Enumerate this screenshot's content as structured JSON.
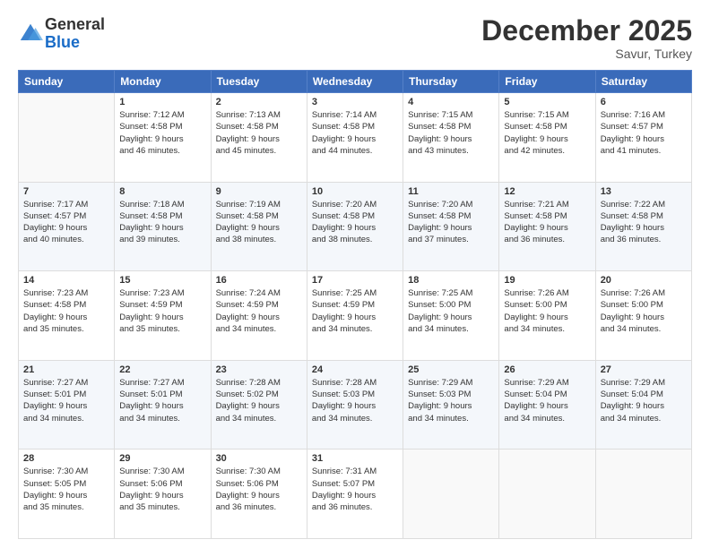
{
  "header": {
    "logo_line1": "General",
    "logo_line2": "Blue",
    "month": "December 2025",
    "location": "Savur, Turkey"
  },
  "days_of_week": [
    "Sunday",
    "Monday",
    "Tuesday",
    "Wednesday",
    "Thursday",
    "Friday",
    "Saturday"
  ],
  "weeks": [
    [
      {
        "day": "",
        "info": ""
      },
      {
        "day": "1",
        "info": "Sunrise: 7:12 AM\nSunset: 4:58 PM\nDaylight: 9 hours\nand 46 minutes."
      },
      {
        "day": "2",
        "info": "Sunrise: 7:13 AM\nSunset: 4:58 PM\nDaylight: 9 hours\nand 45 minutes."
      },
      {
        "day": "3",
        "info": "Sunrise: 7:14 AM\nSunset: 4:58 PM\nDaylight: 9 hours\nand 44 minutes."
      },
      {
        "day": "4",
        "info": "Sunrise: 7:15 AM\nSunset: 4:58 PM\nDaylight: 9 hours\nand 43 minutes."
      },
      {
        "day": "5",
        "info": "Sunrise: 7:15 AM\nSunset: 4:58 PM\nDaylight: 9 hours\nand 42 minutes."
      },
      {
        "day": "6",
        "info": "Sunrise: 7:16 AM\nSunset: 4:57 PM\nDaylight: 9 hours\nand 41 minutes."
      }
    ],
    [
      {
        "day": "7",
        "info": "Sunrise: 7:17 AM\nSunset: 4:57 PM\nDaylight: 9 hours\nand 40 minutes."
      },
      {
        "day": "8",
        "info": "Sunrise: 7:18 AM\nSunset: 4:58 PM\nDaylight: 9 hours\nand 39 minutes."
      },
      {
        "day": "9",
        "info": "Sunrise: 7:19 AM\nSunset: 4:58 PM\nDaylight: 9 hours\nand 38 minutes."
      },
      {
        "day": "10",
        "info": "Sunrise: 7:20 AM\nSunset: 4:58 PM\nDaylight: 9 hours\nand 38 minutes."
      },
      {
        "day": "11",
        "info": "Sunrise: 7:20 AM\nSunset: 4:58 PM\nDaylight: 9 hours\nand 37 minutes."
      },
      {
        "day": "12",
        "info": "Sunrise: 7:21 AM\nSunset: 4:58 PM\nDaylight: 9 hours\nand 36 minutes."
      },
      {
        "day": "13",
        "info": "Sunrise: 7:22 AM\nSunset: 4:58 PM\nDaylight: 9 hours\nand 36 minutes."
      }
    ],
    [
      {
        "day": "14",
        "info": "Sunrise: 7:23 AM\nSunset: 4:58 PM\nDaylight: 9 hours\nand 35 minutes."
      },
      {
        "day": "15",
        "info": "Sunrise: 7:23 AM\nSunset: 4:59 PM\nDaylight: 9 hours\nand 35 minutes."
      },
      {
        "day": "16",
        "info": "Sunrise: 7:24 AM\nSunset: 4:59 PM\nDaylight: 9 hours\nand 34 minutes."
      },
      {
        "day": "17",
        "info": "Sunrise: 7:25 AM\nSunset: 4:59 PM\nDaylight: 9 hours\nand 34 minutes."
      },
      {
        "day": "18",
        "info": "Sunrise: 7:25 AM\nSunset: 5:00 PM\nDaylight: 9 hours\nand 34 minutes."
      },
      {
        "day": "19",
        "info": "Sunrise: 7:26 AM\nSunset: 5:00 PM\nDaylight: 9 hours\nand 34 minutes."
      },
      {
        "day": "20",
        "info": "Sunrise: 7:26 AM\nSunset: 5:00 PM\nDaylight: 9 hours\nand 34 minutes."
      }
    ],
    [
      {
        "day": "21",
        "info": "Sunrise: 7:27 AM\nSunset: 5:01 PM\nDaylight: 9 hours\nand 34 minutes."
      },
      {
        "day": "22",
        "info": "Sunrise: 7:27 AM\nSunset: 5:01 PM\nDaylight: 9 hours\nand 34 minutes."
      },
      {
        "day": "23",
        "info": "Sunrise: 7:28 AM\nSunset: 5:02 PM\nDaylight: 9 hours\nand 34 minutes."
      },
      {
        "day": "24",
        "info": "Sunrise: 7:28 AM\nSunset: 5:03 PM\nDaylight: 9 hours\nand 34 minutes."
      },
      {
        "day": "25",
        "info": "Sunrise: 7:29 AM\nSunset: 5:03 PM\nDaylight: 9 hours\nand 34 minutes."
      },
      {
        "day": "26",
        "info": "Sunrise: 7:29 AM\nSunset: 5:04 PM\nDaylight: 9 hours\nand 34 minutes."
      },
      {
        "day": "27",
        "info": "Sunrise: 7:29 AM\nSunset: 5:04 PM\nDaylight: 9 hours\nand 34 minutes."
      }
    ],
    [
      {
        "day": "28",
        "info": "Sunrise: 7:30 AM\nSunset: 5:05 PM\nDaylight: 9 hours\nand 35 minutes."
      },
      {
        "day": "29",
        "info": "Sunrise: 7:30 AM\nSunset: 5:06 PM\nDaylight: 9 hours\nand 35 minutes."
      },
      {
        "day": "30",
        "info": "Sunrise: 7:30 AM\nSunset: 5:06 PM\nDaylight: 9 hours\nand 36 minutes."
      },
      {
        "day": "31",
        "info": "Sunrise: 7:31 AM\nSunset: 5:07 PM\nDaylight: 9 hours\nand 36 minutes."
      },
      {
        "day": "",
        "info": ""
      },
      {
        "day": "",
        "info": ""
      },
      {
        "day": "",
        "info": ""
      }
    ]
  ]
}
